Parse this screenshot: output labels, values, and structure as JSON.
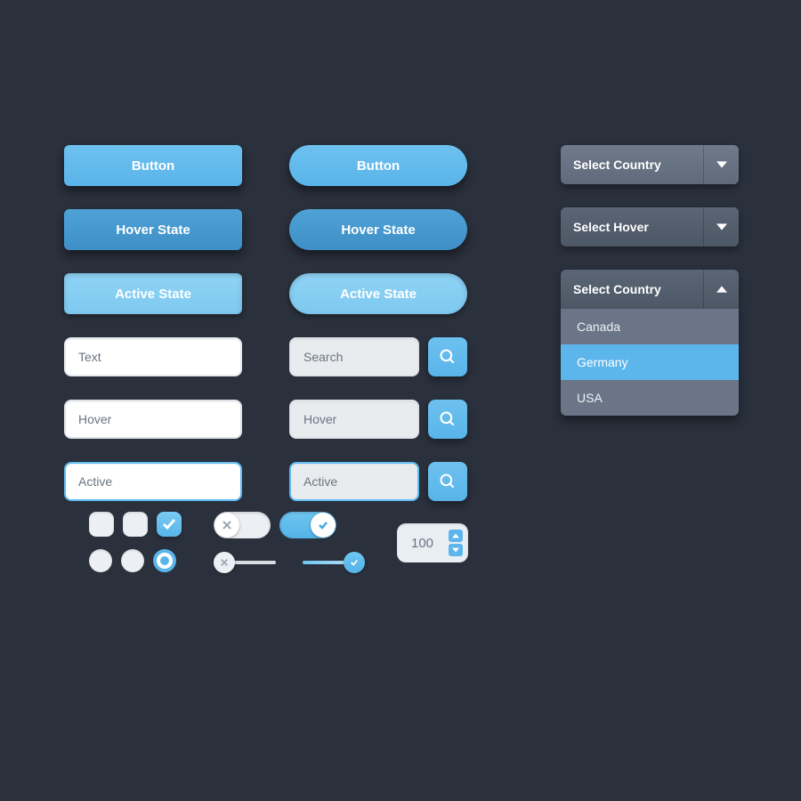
{
  "buttons": {
    "default": "Button",
    "hover": "Hover State",
    "active": "Active State"
  },
  "inputs": {
    "text": "Text",
    "hover": "Hover",
    "active": "Active",
    "search_placeholder": "Search"
  },
  "select": {
    "default_label": "Select Country",
    "hover_label": "Select Hover",
    "open_label": "Select Country",
    "options": [
      "Canada",
      "Germany",
      "USA"
    ],
    "selected_index": 1
  },
  "stepper": {
    "value": "100"
  }
}
